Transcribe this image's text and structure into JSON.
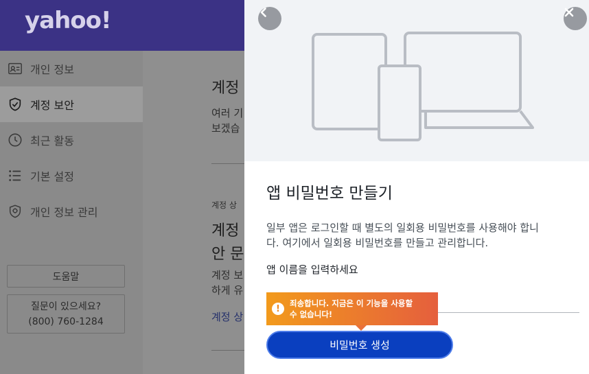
{
  "brand": {
    "logo_text": "yahoo!"
  },
  "sidebar": {
    "items": [
      {
        "label": "개인 정보",
        "icon": "id-card-icon"
      },
      {
        "label": "계정 보안",
        "icon": "shield-check-icon",
        "active": true
      },
      {
        "label": "최근 활동",
        "icon": "clock-icon"
      },
      {
        "label": "기본 설정",
        "icon": "list-icon"
      },
      {
        "label": "개인 정보 관리",
        "icon": "privacy-shield-icon"
      }
    ],
    "help_label": "도움말",
    "contact": {
      "question": "질문이 있으세요?",
      "phone": "(800) 760-1284"
    }
  },
  "main": {
    "title": "계정",
    "desc_line1": "여러 기",
    "desc_line2": "보겠습",
    "section_small": "계정 상",
    "heading_line1": "계정",
    "heading_line2": "안 문",
    "para_line1": "계정 보",
    "para_line2": "하게 유",
    "link": "계정 상"
  },
  "modal": {
    "title": "앱 비밀번호 만들기",
    "desc_line1": "일부 앱은 로그인할 때 별도의 일회용 비밀번호를 사용해야 합니",
    "desc_line2": "다. 여기에서 일회용 비밀번호를 만들고 관리합니다.",
    "input_label": "앱 이름을 입력하세요",
    "input_value": "",
    "error_line1": "죄송합니다. 지금은 이 기능을 사용할",
    "error_line2": "수 없습니다!",
    "generate_button": "비밀번호 생성"
  },
  "colors": {
    "topbar": "#3b3285",
    "primary_button": "#0a3fbf",
    "toast_start": "#f29a1c",
    "toast_end": "#e55f3d",
    "hero_bg": "#f1f3f6"
  }
}
